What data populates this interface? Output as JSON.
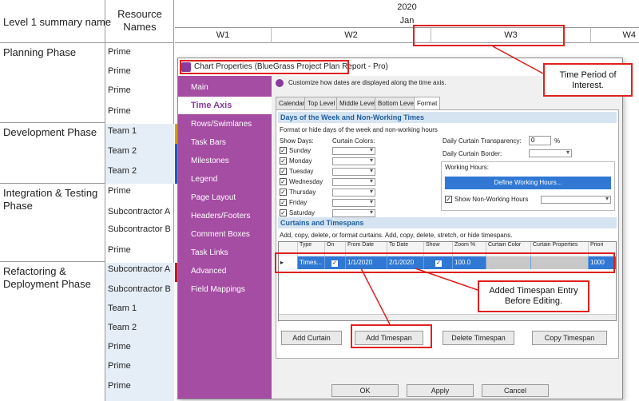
{
  "gantt": {
    "header": {
      "summary_col": "Level 1 summary name",
      "resource_col": "Resource Names"
    },
    "timeline": {
      "year": "2020",
      "month": "Jan",
      "weeks": [
        "W1",
        "W2",
        "W3",
        "W4"
      ]
    },
    "groups": [
      {
        "name": "Planning Phase",
        "resources": [
          "Prime",
          "Prime",
          "Prime",
          "Prime"
        ]
      },
      {
        "name": "Development Phase",
        "resources": [
          "Team 1",
          "Team 2",
          "Team 2"
        ]
      },
      {
        "name": "Integration & Testing Phase",
        "resources": [
          "Prime",
          "Subcontractor A",
          "Subcontractor B",
          "Prime"
        ]
      },
      {
        "name": "Refactoring & Deployment Phase",
        "resources": [
          "Subcontractor A",
          "Subcontractor B",
          "Team 1",
          "Team 2",
          "Prime",
          "Prime",
          "Prime"
        ]
      }
    ]
  },
  "dialog": {
    "title": "Chart Properties (BlueGrass Project Plan Report - Pro)",
    "intro": "Customize how dates are displayed along the time axis.",
    "nav": [
      "Main",
      "Time Axis",
      "Rows/Swimlanes",
      "Task Bars",
      "Milestones",
      "Legend",
      "Page Layout",
      "Headers/Footers",
      "Comment Boxes",
      "Task Links",
      "Advanced",
      "Field Mappings"
    ],
    "nav_selected": "Time Axis",
    "tabs": [
      "Calendar",
      "Top Level",
      "Middle Level",
      "Bottom Level",
      "Format"
    ],
    "tab_selected": "Format",
    "days_section": {
      "title": "Days of the Week and Non-Working Times",
      "desc": "Format or hide days of the week and non-working hours",
      "show_days_label": "Show Days:",
      "curtain_colors_label": "Curtain Colors:",
      "days": [
        "Sunday",
        "Monday",
        "Tuesday",
        "Wednesday",
        "Thursday",
        "Friday",
        "Saturday"
      ],
      "transparency_label": "Daily Curtain Transparency:",
      "transparency_value": "0",
      "transparency_unit": "%",
      "border_label": "Daily Curtain Border:",
      "working_hours_label": "Working Hours:",
      "define_button": "Define Working Hours...",
      "show_nonworking_label": "Show Non-Working Hours"
    },
    "curtains_section": {
      "title": "Curtains and Timespans",
      "desc": "Add, copy, delete, or format curtains.  Add, copy, delete, stretch, or hide timespans.",
      "columns": [
        "",
        "Type",
        "On",
        "From Date",
        "To Date",
        "Show",
        "Zoom %",
        "Curtain Color",
        "Curtain Properties",
        "Priori"
      ],
      "row": {
        "type": "Times...",
        "from": "1/1/2020",
        "to": "2/1/2020",
        "zoom": "100.0",
        "priority": "1000"
      },
      "buttons": [
        "Add Curtain",
        "Add Timespan",
        "Delete Timespan",
        "Copy Timespan"
      ]
    },
    "footer_buttons": [
      "OK",
      "Apply",
      "Cancel"
    ]
  },
  "callouts": {
    "time_period": "Time Period of Interest.",
    "timespan": "Added Timespan  Entry Before Editing."
  },
  "colors": {
    "nav_bg": "#a54ca3",
    "highlight": "#3078d4",
    "annotation": "#e02020"
  }
}
